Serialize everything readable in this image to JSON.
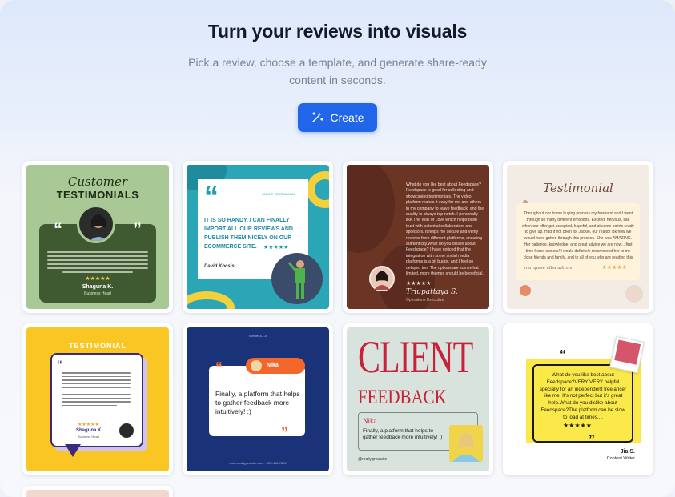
{
  "hero": {
    "title": "Turn your reviews into visuals",
    "subtitle": "Pick a review, choose a template, and generate share-ready content in seconds.",
    "create_label": "Create"
  },
  "colors": {
    "accent": "#2166e8",
    "title": "#14192a",
    "subtitle": "#7a8193"
  },
  "templates": [
    {
      "id": "green-testimonials",
      "heading_script": "Customer",
      "heading": "TESTIMONIALS",
      "name": "Shaguna K.",
      "role": "Business Head",
      "stars": "★★★★★"
    },
    {
      "id": "teal-handy",
      "label": "CLIENT TESTIMONIAL",
      "quote": "IT IS SO HANDY. I CAN FINALLY IMPORT ALL OUR REVIEWS AND PUBLISH THEM NICELY ON OUR ECOMMERCE SITE.",
      "name": "David Kocsis",
      "stars": "★★★★★"
    },
    {
      "id": "brown-feedspace",
      "quote": "What do you like best about Feedspace?Feedspace is good for collecting and showcasing testimonials. The video platform makes it easy for me and others in my company to leave feedback, and the quality is always top-notch. I personally like The Wall of Love which helps build trust with potential collaborators and sponsors. It helps me secure and verify reviews from different platforms, ensuring authenticity.What do you dislike about Feedspace? I have noticed that the integration with some social media platforms is a bit buggy, and I feel so delayed too. The options are somewhat limited, more themes should be beneficial. Prices should be made a little affordable.",
      "name": "Triupattaya S.",
      "role": "Operations Executive",
      "stars": "★★★★★"
    },
    {
      "id": "beige-testimonial",
      "heading": "Testimonial",
      "quote": "Throughout our home buying process my husband and I went through so many different emotions. Excited, nervous, sad when our offer got accepted, hopeful, and at some points ready to give up. Had it not been for Jackie, our realtor idk how we would have gotten through this process. She was AMAZING. Her patience, knowledge, and great advice we are now... first time home owners! I would definitely recommend her to my close friends and family, and to all of you who are reading this message.",
      "name": "marquise alba adams",
      "stars": "★★★★★"
    },
    {
      "id": "yellow-testimonial",
      "heading": "TESTIMONIAL",
      "name": "Shaguna K.",
      "role": "Business Head",
      "stars": "★★★★★"
    },
    {
      "id": "navy-nika",
      "top_label": "Softnet & Co",
      "name": "Nika",
      "quote": "Finally, a platform that helps to gather feedback more intuitively! :)",
      "footer": "www.reallygreatsite.com    +123-456-7890"
    },
    {
      "id": "client-feedback",
      "heading1": "CLIENT",
      "heading2": "FEEDBACK",
      "name": "Nika",
      "quote": "Finally, a platform that helps to gather feedback more intuitively! :)",
      "handle": "@reallygreatsite"
    },
    {
      "id": "yellow-jia",
      "quote": "What do you like best about Feedspace?VERY VERY helpful specially for an independent freelancer like me. It's not perfect but it's great help.What do you dislike about Feedspace?The platform can be slow to load at times....",
      "name": "Jia S.",
      "role": "Content Writer",
      "stars": "★★★★★"
    }
  ]
}
